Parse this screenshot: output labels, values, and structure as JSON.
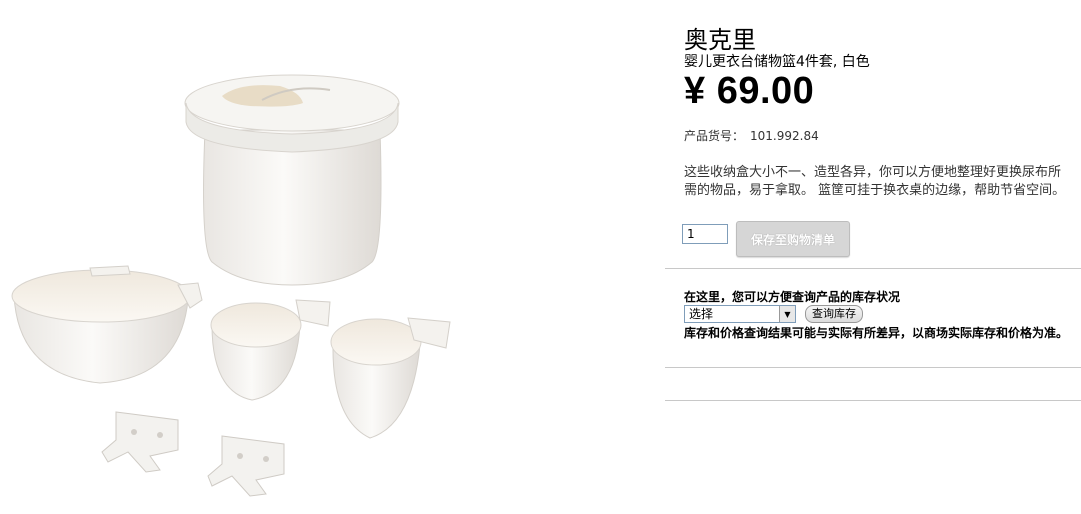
{
  "product": {
    "name": "奥克里",
    "subtitle": "婴儿更衣台储物篮4件套, 白色",
    "price": "¥ 69.00",
    "article_label": "产品货号：",
    "article_number": "101.992.84",
    "description": "这些收纳盒大小不一、造型各异，你可以方便地整理好更换尿布所需的物品，易于拿取。 篮筐可挂于换衣桌的边缘，帮助节省空间。",
    "image": {
      "content": "white storage basket set with lid container, three hanging baskets and two brackets"
    }
  },
  "purchase": {
    "quantity_value": "1",
    "save_button_label": "保存至购物清单"
  },
  "stock": {
    "title": "在这里，您可以方便查询产品的库存状况",
    "select_value": "选择",
    "check_button_label": "查询库存",
    "disclaimer": "库存和价格查询结果可能与实际有所差异，以商场实际库存和价格为准。"
  }
}
